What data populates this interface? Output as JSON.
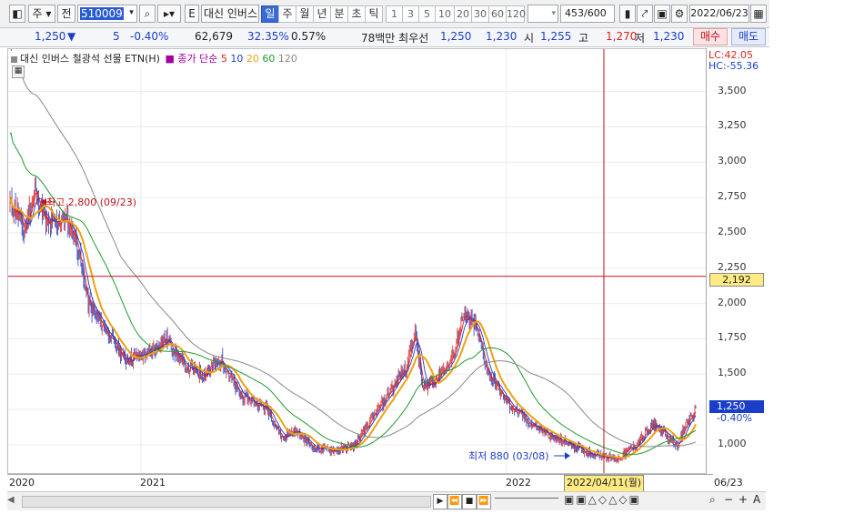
{
  "toolbar": {
    "period_type": "주",
    "market": "전",
    "code": "510009",
    "e_label": "E",
    "stock_name": "대신 인버스",
    "periods": [
      "일",
      "주",
      "월",
      "년",
      "분",
      "초",
      "틱"
    ],
    "selected_period": "일",
    "intervals": [
      "1",
      "3",
      "5",
      "10",
      "20",
      "30",
      "60",
      "120"
    ],
    "count": "453",
    "count_total": "/600",
    "date": "2022/06/23"
  },
  "quote": {
    "price": "1,250",
    "change_arrow": "▼",
    "change": "5",
    "change_pct": "-0.40%",
    "volume": "62,679",
    "vol_ratio": "32.35%",
    "turnover": "0.57%",
    "best_label": "78백만 최우선",
    "ask": "1,250",
    "bid": "1,230",
    "open_label": "시",
    "open": "1,255",
    "high_label": "고",
    "high": "1,270",
    "low_label": "저",
    "low": "1,230",
    "buy_label": "매수",
    "sell_label": "매도"
  },
  "legend": {
    "title": "대신 인버스 철광석 선물 ETN(H)",
    "ma_label": "종가 단순",
    "ma_periods": [
      "5",
      "10",
      "20",
      "60",
      "120"
    ],
    "lc": "LC:42.05",
    "hc": "HC:-55.36"
  },
  "yaxis": {
    "ticks": [
      "3,500",
      "3,250",
      "3,000",
      "2,750",
      "2,500",
      "2,250",
      "2,000",
      "1,750",
      "1,500",
      "1,250",
      "1,000"
    ],
    "crosshair_value": "2,192",
    "last_price": "1,250",
    "last_change_pct": "-0.40%"
  },
  "xaxis": {
    "labels": [
      "2020",
      "2021",
      "2022",
      "06/23"
    ],
    "crosshair_date": "2022/04/11(월)"
  },
  "annotations": {
    "high": "최고 2,800 (09/23)",
    "low": "최저 880 (03/08)"
  },
  "colors": {
    "up": "#e0221c",
    "down": "#1a3ec8",
    "ma5": "#e0221c",
    "ma10": "#1a3ec8",
    "ma20": "#f0a010",
    "ma60": "#1e9a2e",
    "ma120": "#888888"
  },
  "chart_data": {
    "type": "candlestick",
    "y_range": [
      800,
      3800
    ],
    "anchors": [
      {
        "t": 0,
        "v": 2700
      },
      {
        "t": 8,
        "v": 2650
      },
      {
        "t": 15,
        "v": 2500
      },
      {
        "t": 27,
        "v": 2800
      },
      {
        "t": 40,
        "v": 2550
      },
      {
        "t": 60,
        "v": 2600
      },
      {
        "t": 72,
        "v": 2450
      },
      {
        "t": 85,
        "v": 2000
      },
      {
        "t": 105,
        "v": 1800
      },
      {
        "t": 125,
        "v": 1600
      },
      {
        "t": 150,
        "v": 1650
      },
      {
        "t": 170,
        "v": 1750
      },
      {
        "t": 190,
        "v": 1550
      },
      {
        "t": 210,
        "v": 1500
      },
      {
        "t": 230,
        "v": 1600
      },
      {
        "t": 250,
        "v": 1350
      },
      {
        "t": 280,
        "v": 1250
      },
      {
        "t": 295,
        "v": 1050
      },
      {
        "t": 310,
        "v": 1100
      },
      {
        "t": 330,
        "v": 980
      },
      {
        "t": 355,
        "v": 960
      },
      {
        "t": 375,
        "v": 1000
      },
      {
        "t": 390,
        "v": 1150
      },
      {
        "t": 405,
        "v": 1300
      },
      {
        "t": 430,
        "v": 1550
      },
      {
        "t": 440,
        "v": 1800
      },
      {
        "t": 448,
        "v": 1400
      },
      {
        "t": 460,
        "v": 1450
      },
      {
        "t": 480,
        "v": 1600
      },
      {
        "t": 492,
        "v": 1900
      },
      {
        "t": 505,
        "v": 1850
      },
      {
        "t": 520,
        "v": 1500
      },
      {
        "t": 540,
        "v": 1300
      },
      {
        "t": 565,
        "v": 1150
      },
      {
        "t": 590,
        "v": 1050
      },
      {
        "t": 610,
        "v": 1000
      },
      {
        "t": 625,
        "v": 950
      },
      {
        "t": 645,
        "v": 920
      },
      {
        "t": 660,
        "v": 900
      },
      {
        "t": 680,
        "v": 1000
      },
      {
        "t": 700,
        "v": 1150
      },
      {
        "t": 715,
        "v": 1050
      },
      {
        "t": 725,
        "v": 1000
      },
      {
        "t": 735,
        "v": 1150
      },
      {
        "t": 745,
        "v": 1250
      }
    ]
  }
}
